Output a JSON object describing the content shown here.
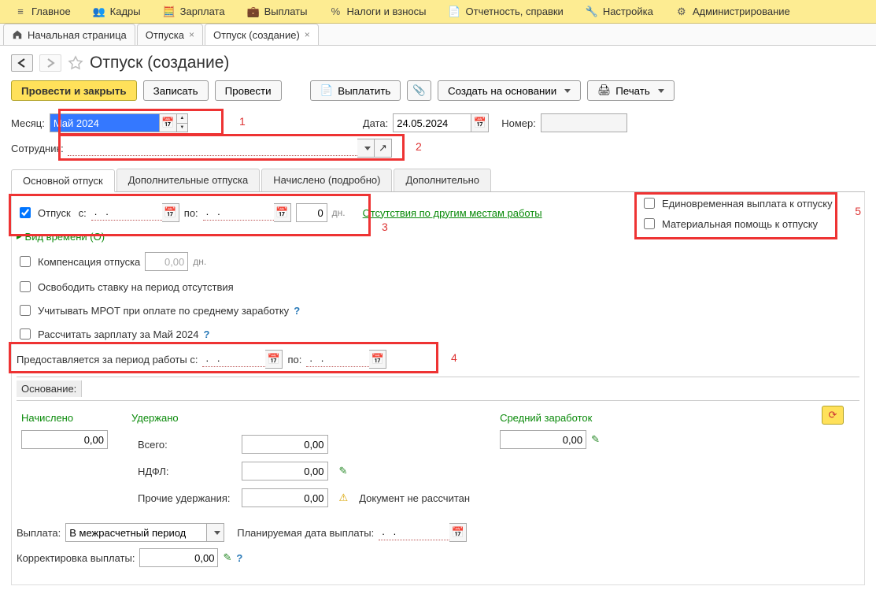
{
  "top_menu": {
    "items": [
      {
        "icon": "≡",
        "label": "Главное"
      },
      {
        "icon": "👥",
        "label": "Кадры"
      },
      {
        "icon": "🧮",
        "label": "Зарплата"
      },
      {
        "icon": "💼",
        "label": "Выплаты"
      },
      {
        "icon": "%",
        "label": "Налоги и взносы"
      },
      {
        "icon": "📄",
        "label": "Отчетность, справки"
      },
      {
        "icon": "🔧",
        "label": "Настройка"
      },
      {
        "icon": "⚙",
        "label": "Администрирование"
      }
    ]
  },
  "tabs": {
    "items": [
      {
        "label": "Начальная страница",
        "home": true
      },
      {
        "label": "Отпуска",
        "closable": true
      },
      {
        "label": "Отпуск (создание)",
        "closable": true,
        "active": true
      }
    ]
  },
  "page_title": "Отпуск (создание)",
  "toolbar": {
    "post_close": "Провести и закрыть",
    "save": "Записать",
    "post": "Провести",
    "pay": "Выплатить",
    "create_based": "Создать на основании",
    "print": "Печать"
  },
  "header_fields": {
    "month_label": "Месяц:",
    "month_value": "Май 2024",
    "date_label": "Дата:",
    "date_value": "24.05.2024",
    "number_label": "Номер:",
    "number_value": "",
    "employee_label": "Сотрудник:",
    "employee_value": ""
  },
  "inner_tabs": {
    "items": [
      "Основной отпуск",
      "Дополнительные отпуска",
      "Начислено (подробно)",
      "Дополнительно"
    ]
  },
  "main_tab": {
    "vacation_chk": "Отпуск",
    "from_label": "с:",
    "from_value": ".   .",
    "to_label": "по:",
    "to_value": ".   .",
    "days_value": "0",
    "days_unit": "дн.",
    "other_absences_link": "Отсутствия по другим местам работы",
    "time_type": "Вид времени (О)",
    "comp_label": "Компенсация отпуска",
    "comp_value": "0,00",
    "comp_unit": "дн.",
    "free_rate": "Освободить ставку на период отсутствия",
    "mrot": "Учитывать МРОТ при оплате по среднему заработку",
    "calc_salary": "Рассчитать зарплату за Май 2024",
    "period_label": "Предоставляется за период работы с:",
    "period_from": ".   .",
    "period_to_label": "по:",
    "period_to": ".   .",
    "lump_sum": "Единовременная выплата к отпуску",
    "mat_help": "Материальная помощь к отпуску"
  },
  "basis": {
    "label": "Основание:",
    "value": ""
  },
  "calc": {
    "accrued_h": "Начислено",
    "accrued_val": "0,00",
    "withheld_h": "Удержано",
    "total_label": "Всего:",
    "total_val": "0,00",
    "ndfl_label": "НДФЛ:",
    "ndfl_val": "0,00",
    "other_label": "Прочие удержания:",
    "other_val": "0,00",
    "avg_h": "Средний заработок",
    "avg_val": "0,00",
    "not_calc": "Документ не рассчитан"
  },
  "payment": {
    "label": "Выплата:",
    "value": "В межрасчетный период",
    "planned_label": "Планируемая дата выплаты:",
    "planned_value": ".   .",
    "corr_label": "Корректировка выплаты:",
    "corr_value": "0,00"
  },
  "markers": {
    "m1": "1",
    "m2": "2",
    "m3": "3",
    "m4": "4",
    "m5": "5"
  }
}
